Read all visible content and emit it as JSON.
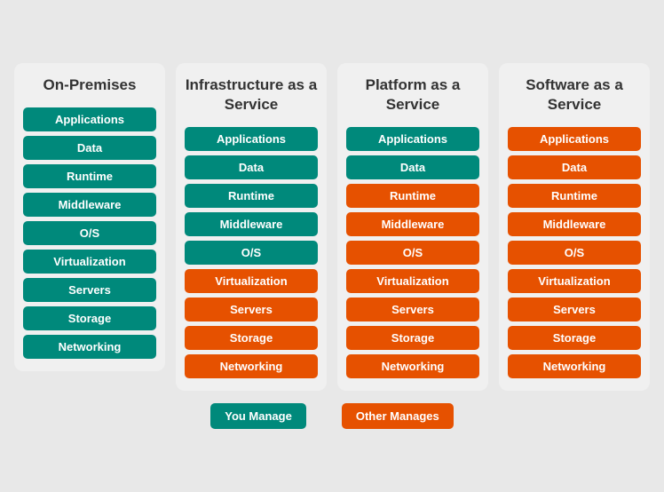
{
  "columns": [
    {
      "id": "on-premises",
      "title": "On-Premises",
      "items": [
        {
          "label": "Applications",
          "color": "teal"
        },
        {
          "label": "Data",
          "color": "teal"
        },
        {
          "label": "Runtime",
          "color": "teal"
        },
        {
          "label": "Middleware",
          "color": "teal"
        },
        {
          "label": "O/S",
          "color": "teal"
        },
        {
          "label": "Virtualization",
          "color": "teal"
        },
        {
          "label": "Servers",
          "color": "teal"
        },
        {
          "label": "Storage",
          "color": "teal"
        },
        {
          "label": "Networking",
          "color": "teal"
        }
      ]
    },
    {
      "id": "iaas",
      "title": "Infrastructure as a Service",
      "items": [
        {
          "label": "Applications",
          "color": "teal"
        },
        {
          "label": "Data",
          "color": "teal"
        },
        {
          "label": "Runtime",
          "color": "teal"
        },
        {
          "label": "Middleware",
          "color": "teal"
        },
        {
          "label": "O/S",
          "color": "teal"
        },
        {
          "label": "Virtualization",
          "color": "orange"
        },
        {
          "label": "Servers",
          "color": "orange"
        },
        {
          "label": "Storage",
          "color": "orange"
        },
        {
          "label": "Networking",
          "color": "orange"
        }
      ]
    },
    {
      "id": "paas",
      "title": "Platform as a Service",
      "items": [
        {
          "label": "Applications",
          "color": "teal"
        },
        {
          "label": "Data",
          "color": "teal"
        },
        {
          "label": "Runtime",
          "color": "orange"
        },
        {
          "label": "Middleware",
          "color": "orange"
        },
        {
          "label": "O/S",
          "color": "orange"
        },
        {
          "label": "Virtualization",
          "color": "orange"
        },
        {
          "label": "Servers",
          "color": "orange"
        },
        {
          "label": "Storage",
          "color": "orange"
        },
        {
          "label": "Networking",
          "color": "orange"
        }
      ]
    },
    {
      "id": "saas",
      "title": "Software as a Service",
      "items": [
        {
          "label": "Applications",
          "color": "orange"
        },
        {
          "label": "Data",
          "color": "orange"
        },
        {
          "label": "Runtime",
          "color": "orange"
        },
        {
          "label": "Middleware",
          "color": "orange"
        },
        {
          "label": "O/S",
          "color": "orange"
        },
        {
          "label": "Virtualization",
          "color": "orange"
        },
        {
          "label": "Servers",
          "color": "orange"
        },
        {
          "label": "Storage",
          "color": "orange"
        },
        {
          "label": "Networking",
          "color": "orange"
        }
      ]
    }
  ],
  "legend": {
    "you_manage": "You Manage",
    "other_manages": "Other Manages"
  }
}
